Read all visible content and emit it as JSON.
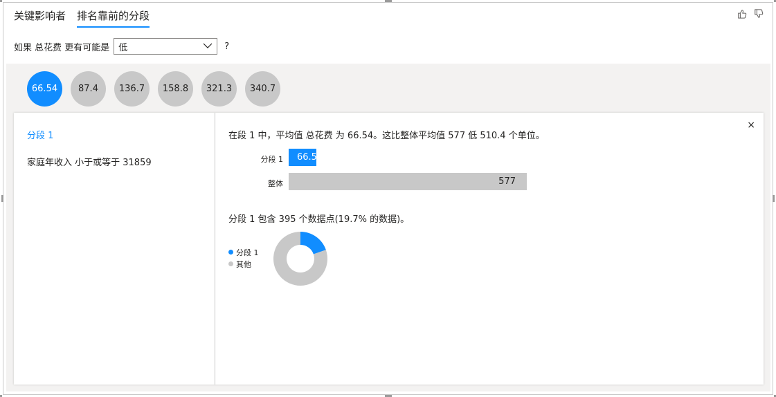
{
  "tabs": [
    {
      "label": "关键影响者",
      "active": false
    },
    {
      "label": "排名靠前的分段",
      "active": true
    }
  ],
  "filter": {
    "prefix": "如果 总花费 更有可能是",
    "selected": "低",
    "suffix": "?"
  },
  "segments": [
    "66.54",
    "87.4",
    "136.7",
    "158.8",
    "321.3",
    "340.7"
  ],
  "active_segment_index": 0,
  "detail": {
    "segment_title": "分段 1",
    "condition": "家庭年收入 小于或等于 31859",
    "summary": "在段 1 中，平均值 总花费 为 66.54。这比整体平均值 577 低 510.4 个单位。",
    "close_label": "×",
    "bars": [
      {
        "label": "分段 1",
        "value_text": "66.54",
        "value": 66.54
      },
      {
        "label": "整体",
        "value_text": "577",
        "value": 577
      }
    ],
    "count_text": "分段 1 包含 395 个数据点(19.7% 的数据)。",
    "legend": [
      {
        "label": "分段 1",
        "color": "#118dff"
      },
      {
        "label": "其他",
        "color": "#c8c8c8"
      }
    ],
    "donut_fraction": 0.197
  },
  "colors": {
    "accent": "#118dff",
    "neutral": "#c8c8c8"
  },
  "icons": {
    "thumbs_up": "thumbs-up-icon",
    "thumbs_down": "thumbs-down-icon",
    "dropdown": "chevron-down-icon",
    "close": "close-icon"
  }
}
